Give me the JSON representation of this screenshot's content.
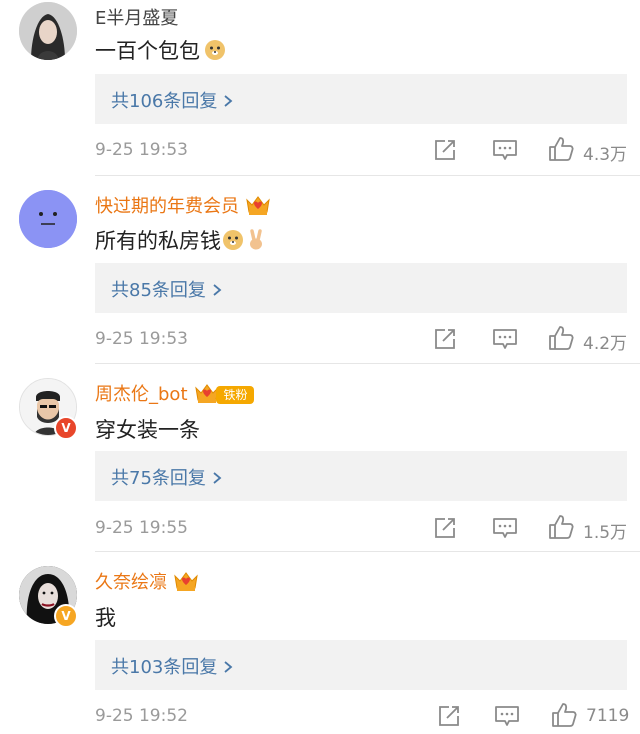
{
  "comments": [
    {
      "username": "E半月盛夏",
      "text": "一百个包包",
      "emoji": "doge-emoji",
      "reply_label": "共106条回复",
      "time": "9-25 19:53",
      "likes": "4.3万"
    },
    {
      "username": "快过期的年费会员",
      "text": "所有的私房钱",
      "emoji": "doge-emoji, victory-hand-emoji",
      "reply_label": "共85条回复",
      "time": "9-25 19:53",
      "likes": "4.2万"
    },
    {
      "username": "周杰伦_bot",
      "badge": "铁粉",
      "text": "穿女装一条",
      "reply_label": "共75条回复",
      "time": "9-25 19:55",
      "likes": "1.5万"
    },
    {
      "username": "久奈绘凛",
      "text": "我",
      "reply_label": "共103条回复",
      "time": "9-25 19:52",
      "likes": "7119"
    }
  ],
  "colors": {
    "vip_name": "#ea7715",
    "reply_link": "#4a78a8",
    "verified_badge": "#f6a623",
    "timestamp": "#9a9a9a"
  },
  "icons": [
    "share-icon",
    "comment-icon",
    "like-icon",
    "crown-icon",
    "chevron-right-icon",
    "verified-badge-icon"
  ]
}
